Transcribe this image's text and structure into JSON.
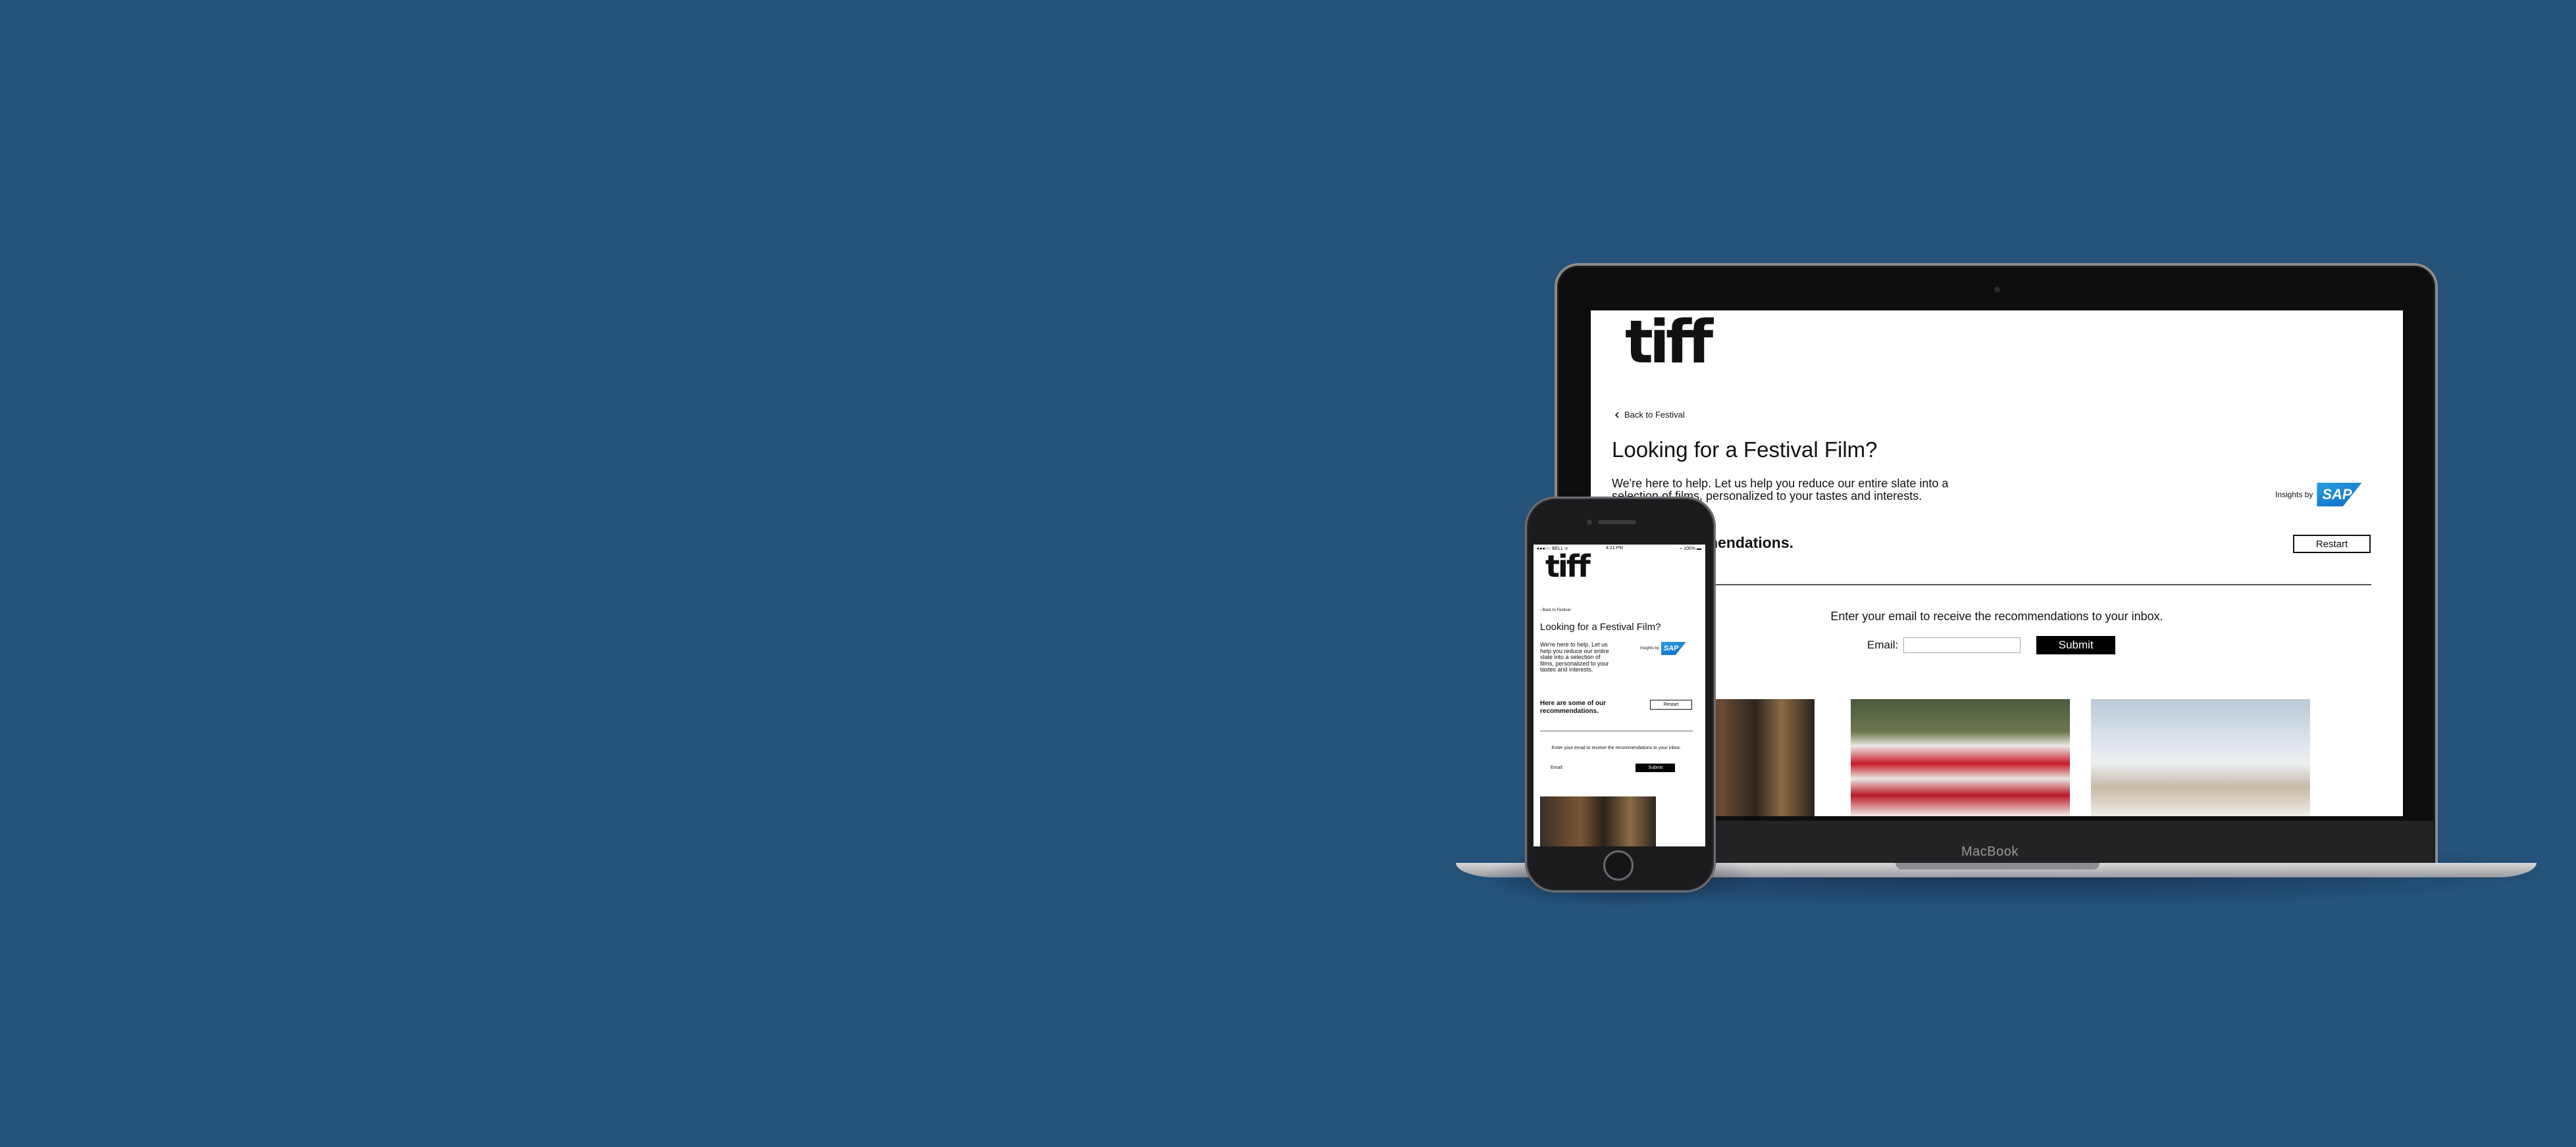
{
  "laptop": {
    "brand_label": "MacBook",
    "page": {
      "logo_text": "tiff",
      "back_link": "Back to Festival",
      "title": "Looking for a Festival Film?",
      "intro": "We're here to help. Let us help you reduce our entire slate into a selection of films, personalized to your tastes and interests.",
      "insights_label": "Insights by",
      "insights_logo": "SAP",
      "recommendations_heading": "of our recommendations.",
      "restart_label": "Restart",
      "email_prompt": "Enter your email to receive the recommendations to your inbox.",
      "email_label": "Email:",
      "email_value": "",
      "submit_label": "Submit"
    }
  },
  "phone": {
    "status": {
      "carrier": "●●●○○ BELL ᯤ",
      "time": "4:21 PM",
      "battery": "⌁ 100% ▬"
    },
    "page": {
      "logo_text": "tiff",
      "back_link": "Back to Festival",
      "title": "Looking for a Festival Film?",
      "intro": "We're here to help. Let us help you reduce our entire slate into a selection of films, personalized to your tastes and interests.",
      "insights_label": "Insights by",
      "insights_logo": "SAP",
      "recommendations_heading": "Here are some of our recommendations.",
      "restart_label": "Restart",
      "email_prompt": "Enter your email to receive the recommendations to your inbox.",
      "email_label": "Email:",
      "email_value": "",
      "submit_label": "Submit"
    }
  },
  "colors": {
    "background": "#25527a",
    "sap_blue": "#0a6cc2",
    "text": "#111111"
  },
  "icons": {
    "back": "chevron-left-icon"
  }
}
